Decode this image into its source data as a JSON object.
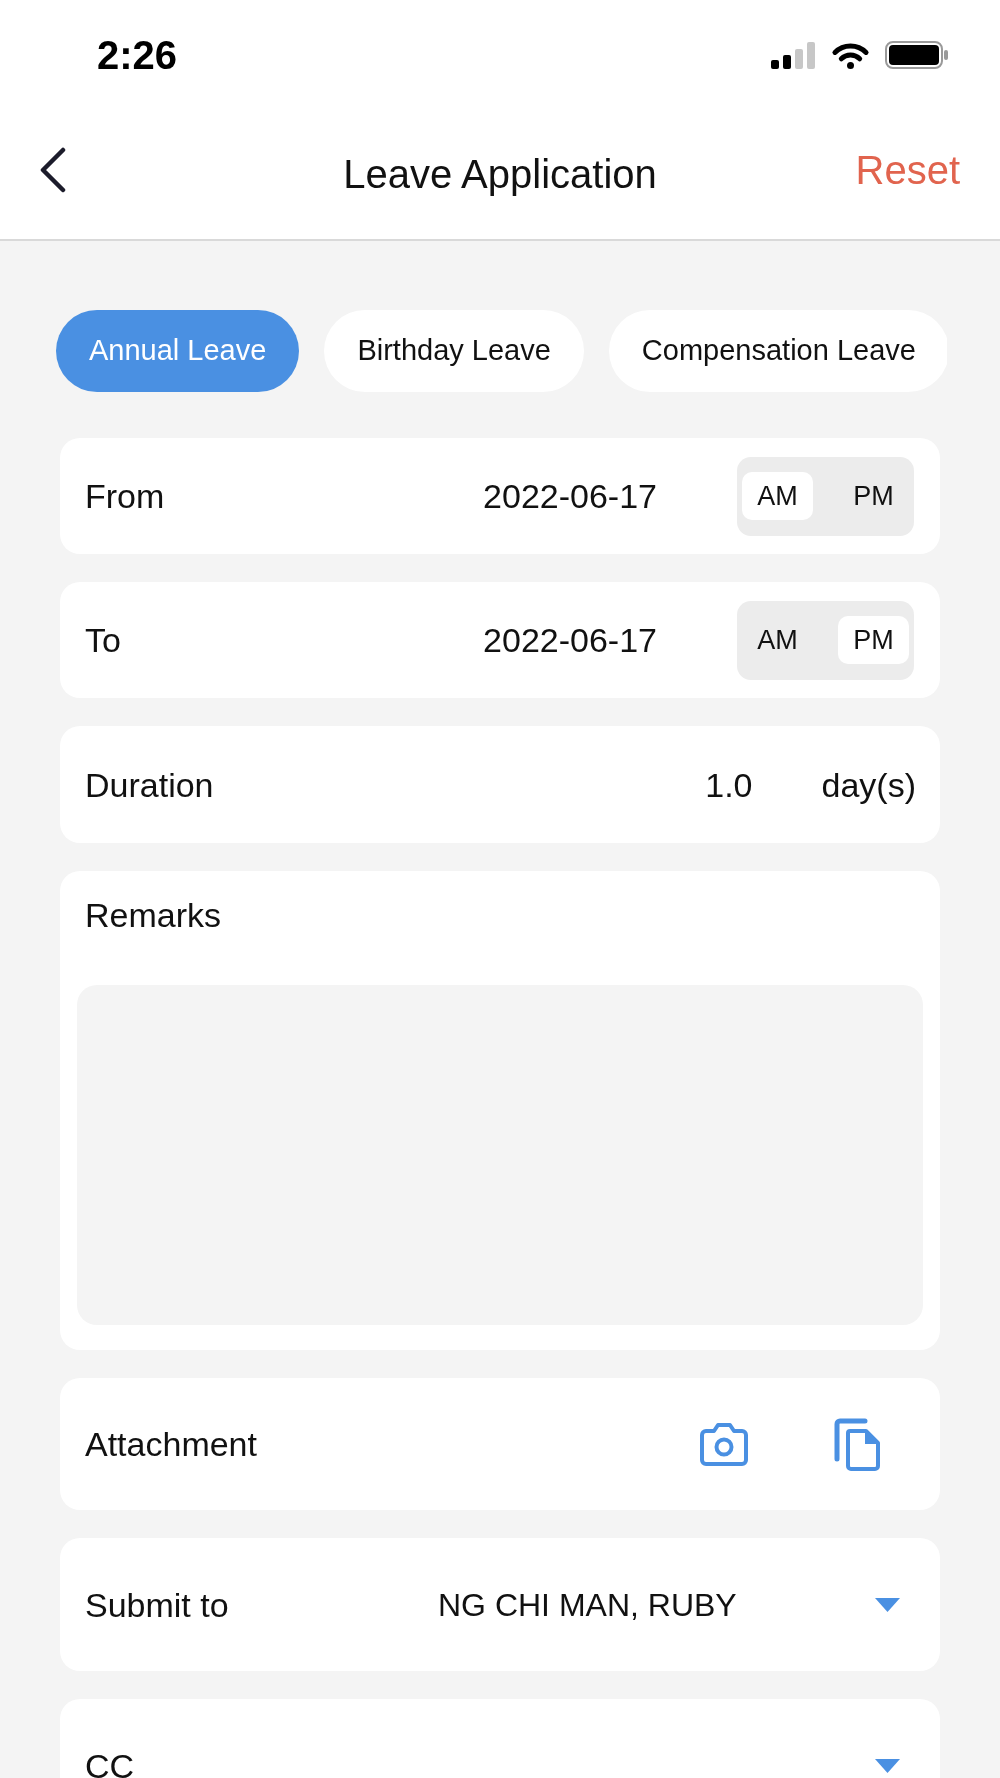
{
  "status_bar": {
    "time": "2:26"
  },
  "nav_bar": {
    "title": "Leave Application",
    "action": "Reset"
  },
  "leave_types": [
    {
      "label": "Annual Leave",
      "selected": true
    },
    {
      "label": "Birthday Leave",
      "selected": false
    },
    {
      "label": "Compensation Leave",
      "selected": false
    }
  ],
  "fields": [
    {
      "kind": "date",
      "label": "From",
      "value": "2022-06-17",
      "periods": [
        {
          "label": "AM",
          "selected": true
        },
        {
          "label": "PM",
          "selected": false
        }
      ]
    },
    {
      "kind": "date",
      "label": "To",
      "value": "2022-06-17",
      "periods": [
        {
          "label": "AM",
          "selected": false
        },
        {
          "label": "PM",
          "selected": true
        }
      ]
    },
    {
      "kind": "number",
      "label": "Duration",
      "value": "1.0",
      "unit": "day(s)"
    },
    {
      "kind": "textarea",
      "label": "Remarks"
    },
    {
      "kind": "attachment",
      "label": "Attachment"
    },
    {
      "kind": "select",
      "label": "Submit to",
      "value": "NG CHI MAN, RUBY"
    },
    {
      "kind": "select",
      "label": "CC"
    }
  ]
}
